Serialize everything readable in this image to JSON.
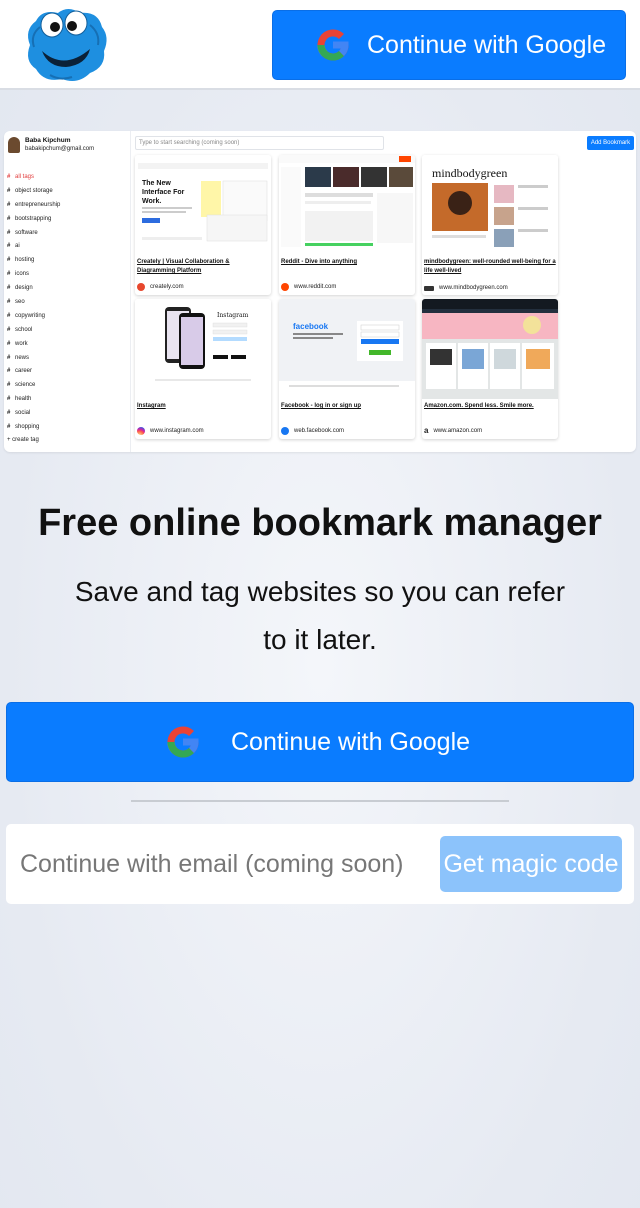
{
  "header": {
    "logo_alt": "cookie monster logo",
    "google_button_label": "Continue with Google"
  },
  "preview": {
    "user": {
      "name": "Baba Kipchum",
      "email": "babakipchum@gmail.com"
    },
    "search_placeholder": "Type to start searching (coming soon)",
    "add_bookmark_label": "Add Bookmark",
    "tags": [
      "all tags",
      "object storage",
      "entrepreneurship",
      "bootstrapping",
      "software",
      "ai",
      "hosting",
      "icons",
      "design",
      "seo",
      "copywriting",
      "school",
      "work",
      "news",
      "career",
      "science",
      "health",
      "social",
      "shopping"
    ],
    "create_tag_label": "create tag",
    "cards": [
      {
        "title": "Creately | Visual Collaboration & Diagramming Platform",
        "domain": "creately.com",
        "fav_color": "#e7472d"
      },
      {
        "title": "Reddit - Dive into anything",
        "domain": "www.reddit.com",
        "fav_color": "#ff4500"
      },
      {
        "title": "mindbodygreen: well-rounded well-being for a life well-lived",
        "domain": "www.mindbodygreen.com",
        "fav_color": "#333333"
      },
      {
        "title": "Instagram",
        "domain": "www.instagram.com",
        "fav_color": "#d6249f"
      },
      {
        "title": "Facebook - log in or sign up",
        "domain": "web.facebook.com",
        "fav_color": "#1877f2"
      },
      {
        "title": "Amazon.com. Spend less. Smile more.",
        "domain": "www.amazon.com",
        "fav_color": "#111111"
      }
    ]
  },
  "hero": {
    "headline": "Free online bookmark manager",
    "subline": "Save and tag websites so you can refer to it later."
  },
  "signin": {
    "google_button_label": "Continue with Google",
    "email_placeholder": "Continue with email (coming soon)",
    "magic_code_label": "Get magic code"
  },
  "colors": {
    "primary": "#0a7cff",
    "primary_disabled": "#8cc3fb",
    "active_tag": "#e23c3c"
  }
}
